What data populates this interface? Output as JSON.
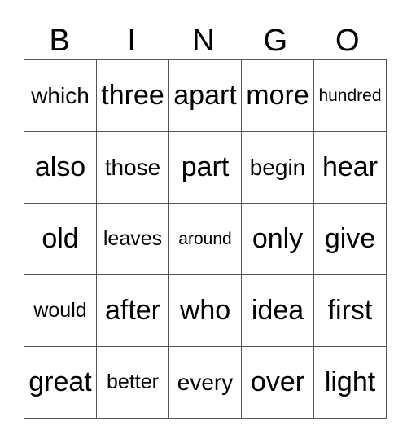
{
  "header": [
    "B",
    "I",
    "N",
    "G",
    "O"
  ],
  "rows": [
    [
      "which",
      "three",
      "apart",
      "more",
      "hundred"
    ],
    [
      "also",
      "those",
      "part",
      "begin",
      "hear"
    ],
    [
      "old",
      "leaves",
      "around",
      "only",
      "give"
    ],
    [
      "would",
      "after",
      "who",
      "idea",
      "first"
    ],
    [
      "great",
      "better",
      "every",
      "over",
      "light"
    ]
  ]
}
